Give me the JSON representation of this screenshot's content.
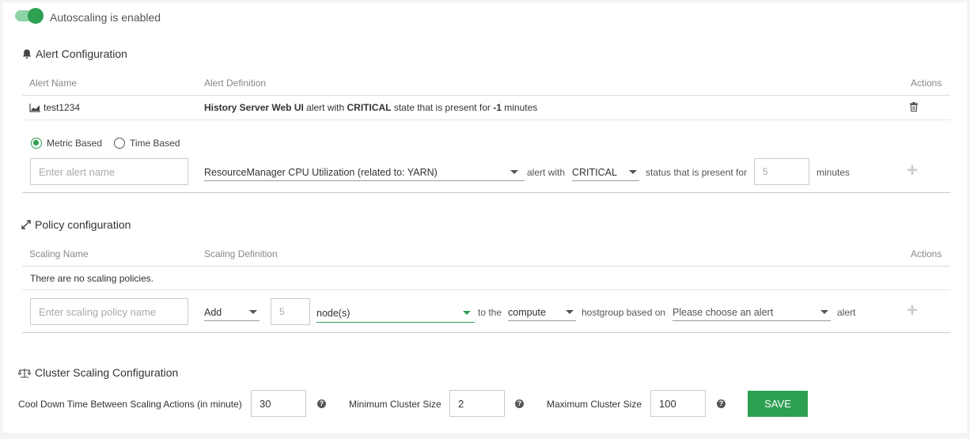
{
  "autoscaling": {
    "label": "Autoscaling is enabled",
    "enabled": true
  },
  "alert_config": {
    "title": "Alert Configuration",
    "columns": {
      "name": "Alert Name",
      "definition": "Alert Definition",
      "actions": "Actions"
    },
    "rows": [
      {
        "name": "test1234",
        "def_bold1": "History Server Web UI",
        "def_text1": " alert with ",
        "def_bold2": "CRITICAL",
        "def_text2": " state that is present for ",
        "def_bold3": "-1",
        "def_text3": " minutes"
      }
    ],
    "form": {
      "radio_metric": "Metric Based",
      "radio_time": "Time Based",
      "selected": "Metric Based",
      "name_placeholder": "Enter alert name",
      "metric_value": "ResourceManager CPU Utilization (related to: YARN)",
      "alert_with": "alert with",
      "state_value": "CRITICAL",
      "status_text": "status that is present for",
      "minutes_placeholder": "5",
      "minutes_label": "minutes"
    }
  },
  "policy_config": {
    "title": "Policy configuration",
    "columns": {
      "name": "Scaling Name",
      "definition": "Scaling Definition",
      "actions": "Actions"
    },
    "empty_text": "There are no scaling policies.",
    "form": {
      "name_placeholder": "Enter scaling policy name",
      "action_value": "Add",
      "count_placeholder": "5",
      "unit_value": "node(s)",
      "to_the": "to the",
      "hostgroup_value": "compute",
      "hostgroup_text": "hostgroup based on",
      "alert_placeholder": "Please choose an alert",
      "alert_text": "alert"
    }
  },
  "cluster_config": {
    "title": "Cluster Scaling Configuration",
    "cooldown_label": "Cool Down Time Between Scaling Actions (in minute)",
    "cooldown_value": "30",
    "min_label": "Minimum Cluster Size",
    "min_value": "2",
    "max_label": "Maximum Cluster Size",
    "max_value": "100",
    "save_label": "SAVE"
  },
  "colors": {
    "accent": "#2ea052",
    "accent_light": "#8fd3a8"
  }
}
